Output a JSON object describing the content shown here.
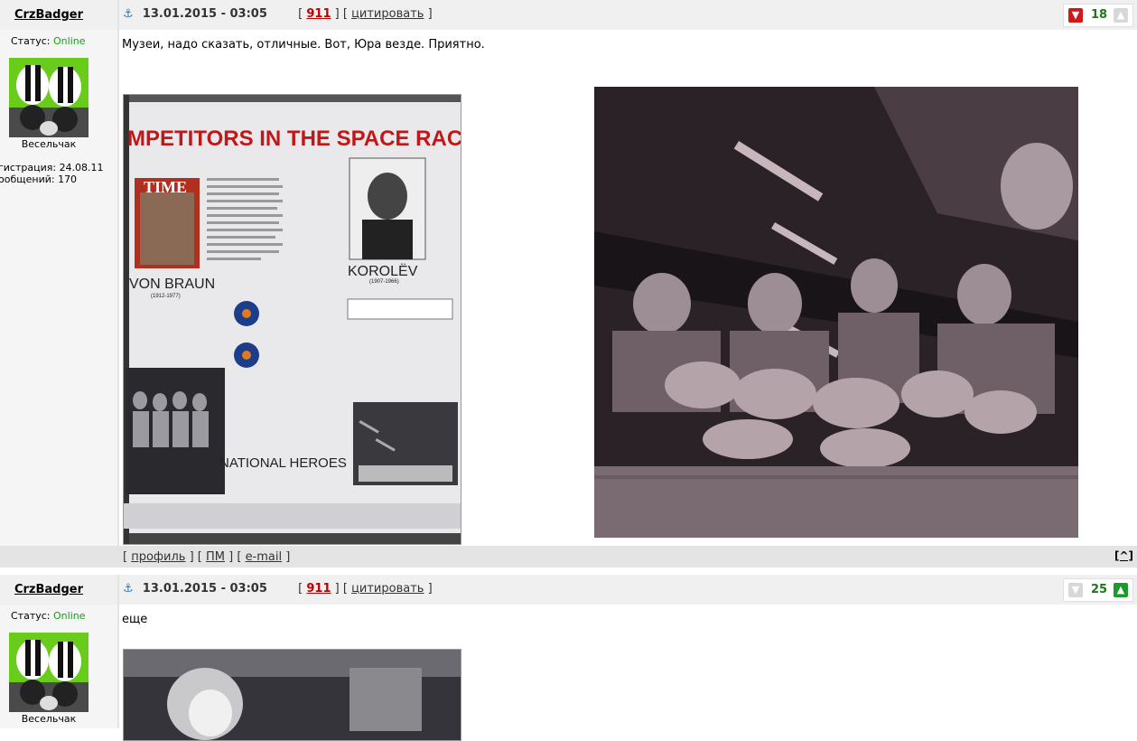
{
  "posts": [
    {
      "username": "CrzBadger",
      "date": "13.01.2015 - 03:05",
      "post_number": "911",
      "quote_label": "цитировать",
      "rating": "18",
      "status_label": "Статус:",
      "status_value": "Online",
      "user_title": "Весельчак",
      "registration": "гистрация: 24.08.11",
      "messages": "ообщений: 170",
      "text": "Музеи, надо сказать, отличные. Вот, Юра везде. Приятно.",
      "poster": {
        "headline": "MPETITORS IN THE SPACE RACE",
        "time_label": "TIME",
        "von_braun": "VON BRAUN",
        "von_braun_years": "(1912-1977)",
        "korolev": "KOROLËV",
        "korolev_years": "(1907-1966)",
        "heroes": "NATIONAL HEROES"
      },
      "footer": {
        "profile": "профиль",
        "pm": "ПМ",
        "email": "e-mail",
        "top": "[^]"
      }
    },
    {
      "username": "CrzBadger",
      "date": "13.01.2015 - 03:05",
      "post_number": "911",
      "quote_label": "цитировать",
      "rating": "25",
      "status_label": "Статус:",
      "status_value": "Online",
      "user_title": "Весельчак",
      "text": "еще"
    }
  ],
  "colors": {
    "online": "#1a9c1a",
    "post_number": "#c00000",
    "rating": "#1a7a1a",
    "thumb_down": "#d11919",
    "thumb_up": "#1a9c2a",
    "avatar_bg": "#6acc1a"
  },
  "icons": [
    "anchor-icon",
    "thumb-down-icon",
    "thumb-up-icon"
  ]
}
